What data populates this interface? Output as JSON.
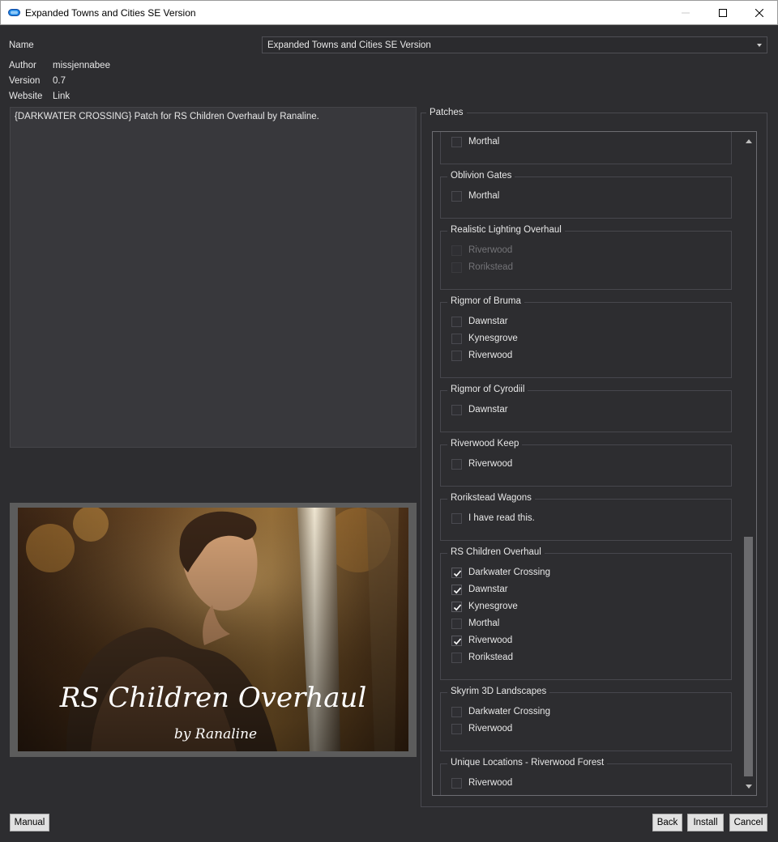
{
  "window": {
    "title": "Expanded Towns and Cities SE Version",
    "icons": {
      "app": "plugin-icon",
      "minimize": "minimize-icon",
      "maximize": "maximize-icon",
      "close": "close-icon"
    }
  },
  "info": {
    "name_label": "Name",
    "name_value": "Expanded Towns and Cities SE Version",
    "author_label": "Author",
    "author_value": "missjennabee",
    "version_label": "Version",
    "version_value": "0.7",
    "website_label": "Website",
    "website_value": "Link"
  },
  "description": "{DARKWATER CROSSING} Patch for RS Children Overhaul by Ranaline.",
  "image": {
    "title": "RS Children Overhaul",
    "subtitle": "by Ranaline"
  },
  "patches": {
    "title": "Patches",
    "groups": [
      {
        "title": "",
        "options": [
          {
            "label": "Morthal",
            "checked": false,
            "disabled": false
          }
        ]
      },
      {
        "title": "Oblivion Gates",
        "options": [
          {
            "label": "Morthal",
            "checked": false,
            "disabled": false
          }
        ]
      },
      {
        "title": "Realistic Lighting Overhaul",
        "options": [
          {
            "label": "Riverwood",
            "checked": false,
            "disabled": true
          },
          {
            "label": "Rorikstead",
            "checked": false,
            "disabled": true
          }
        ]
      },
      {
        "title": "Rigmor of Bruma",
        "options": [
          {
            "label": "Dawnstar",
            "checked": false,
            "disabled": false
          },
          {
            "label": "Kynesgrove",
            "checked": false,
            "disabled": false
          },
          {
            "label": "Riverwood",
            "checked": false,
            "disabled": false
          }
        ]
      },
      {
        "title": "Rigmor of Cyrodiil",
        "options": [
          {
            "label": "Dawnstar",
            "checked": false,
            "disabled": false
          }
        ]
      },
      {
        "title": "Riverwood Keep",
        "options": [
          {
            "label": "Riverwood",
            "checked": false,
            "disabled": false
          }
        ]
      },
      {
        "title": "Rorikstead Wagons",
        "options": [
          {
            "label": "I have read this.",
            "checked": false,
            "disabled": false
          }
        ]
      },
      {
        "title": "RS Children Overhaul",
        "options": [
          {
            "label": "Darkwater Crossing",
            "checked": true,
            "disabled": false
          },
          {
            "label": "Dawnstar",
            "checked": true,
            "disabled": false
          },
          {
            "label": "Kynesgrove",
            "checked": true,
            "disabled": false
          },
          {
            "label": "Morthal",
            "checked": false,
            "disabled": false
          },
          {
            "label": "Riverwood",
            "checked": true,
            "disabled": false
          },
          {
            "label": "Rorikstead",
            "checked": false,
            "disabled": false
          }
        ]
      },
      {
        "title": "Skyrim 3D Landscapes",
        "options": [
          {
            "label": "Darkwater Crossing",
            "checked": false,
            "disabled": false
          },
          {
            "label": "Riverwood",
            "checked": false,
            "disabled": false
          }
        ]
      },
      {
        "title": "Unique Locations - Riverwood Forest",
        "options": [
          {
            "label": "Riverwood",
            "checked": false,
            "disabled": false
          }
        ]
      }
    ]
  },
  "buttons": {
    "manual": "Manual",
    "back": "Back",
    "install": "Install",
    "cancel": "Cancel"
  }
}
